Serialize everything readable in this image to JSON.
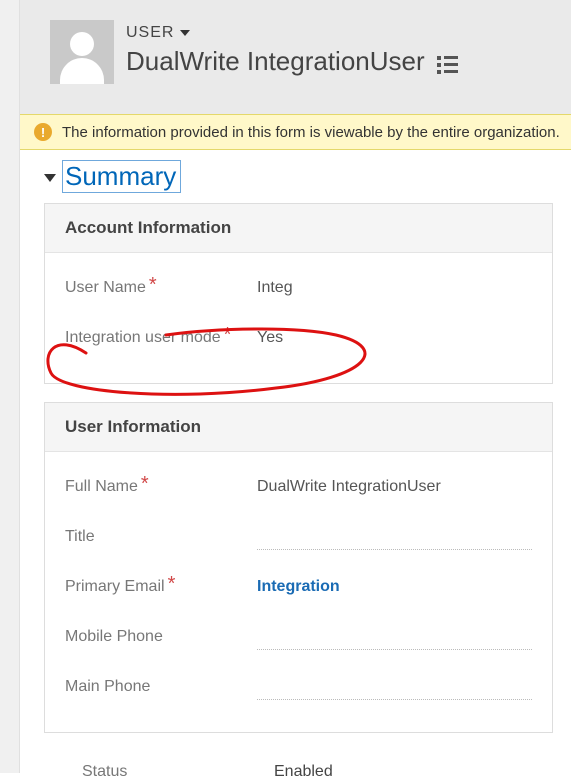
{
  "header": {
    "entity_type": "USER",
    "title": "DualWrite IntegrationUser"
  },
  "notification": {
    "text": "The information provided in this form is viewable by the entire organization."
  },
  "section": {
    "title": "Summary"
  },
  "account_info": {
    "heading": "Account Information",
    "username_label": "User Name",
    "username_value": "Integ",
    "integration_mode_label": "Integration user mode",
    "integration_mode_value": "Yes"
  },
  "user_info": {
    "heading": "User Information",
    "fullname_label": "Full Name",
    "fullname_value": "DualWrite IntegrationUser",
    "title_label": "Title",
    "title_value": "",
    "email_label": "Primary Email",
    "email_value": "Integration",
    "mobile_label": "Mobile Phone",
    "mobile_value": "",
    "main_label": "Main Phone",
    "main_value": ""
  },
  "status": {
    "label": "Status",
    "value": "Enabled"
  }
}
